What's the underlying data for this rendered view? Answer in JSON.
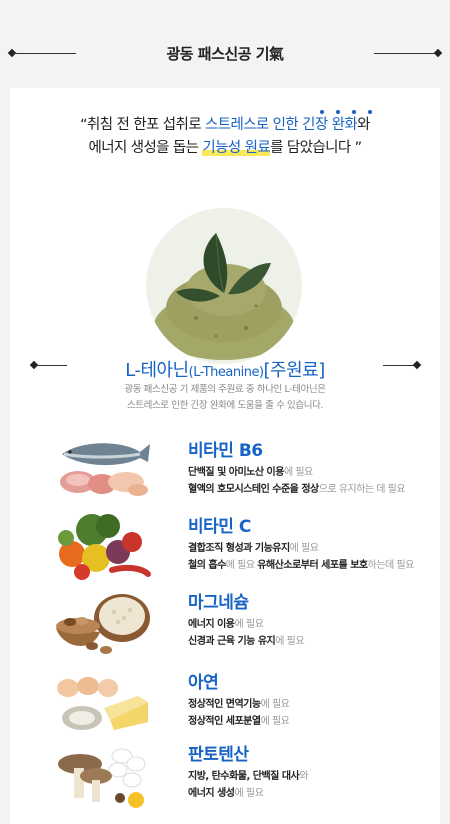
{
  "header": {
    "title": "광동 패스신공 기氣"
  },
  "quote": {
    "line1_pre": "“취침 전 한포 섭취로 ",
    "line1_blue": "스트레스로 인한 긴장 완화",
    "line1_post": "와",
    "line2_pre": "에너지 생성을 돕는 ",
    "line2_hl": "기능성 원료",
    "line2_post": "를 담았습니다 ”"
  },
  "theanine": {
    "title_main": "L-테아닌",
    "title_en": "(L-Theanine)",
    "title_tag": "[주원료]",
    "desc_line1": "광동 패스신공 기 제품의 주원료 중 하나인 L-테아닌은",
    "desc_line2": "스트레스로 인한 긴장 완화에 도움을 줄 수 있습니다."
  },
  "nutrients": [
    {
      "name": "비타민 B6",
      "lines": [
        [
          {
            "t": "단백질 및 아미노산 이용",
            "b": true
          },
          {
            "t": "에 필요",
            "b": false
          }
        ],
        [
          {
            "t": "혈액의 호모시스테인 수준을 정상",
            "b": true
          },
          {
            "t": "으로 유지하는 데 필요",
            "b": false
          }
        ]
      ]
    },
    {
      "name": "비타민 C",
      "lines": [
        [
          {
            "t": "결합조직 형성과 기능유지",
            "b": true
          },
          {
            "t": "에 필요",
            "b": false
          }
        ],
        [
          {
            "t": "철의 흡수",
            "b": true
          },
          {
            "t": "에 필요 ",
            "b": false
          },
          {
            "t": "유해산소로부터 세포를 보호",
            "b": true
          },
          {
            "t": "하는데 필요",
            "b": false
          }
        ]
      ]
    },
    {
      "name": "마그네슘",
      "lines": [
        [
          {
            "t": "에너지 이용",
            "b": true
          },
          {
            "t": "에 필요",
            "b": false
          }
        ],
        [
          {
            "t": "신경과 근육 기능 유지",
            "b": true
          },
          {
            "t": "에 필요",
            "b": false
          }
        ]
      ]
    },
    {
      "name": "아연",
      "lines": [
        [
          {
            "t": "정상적인 면역기능",
            "b": true
          },
          {
            "t": "에 필요",
            "b": false
          }
        ],
        [
          {
            "t": "정상적인 세포분열",
            "b": true
          },
          {
            "t": "에 필요",
            "b": false
          }
        ]
      ]
    },
    {
      "name": "판토텐산",
      "lines": [
        [
          {
            "t": "지방, 탄수화물, 단백질 대사",
            "b": true
          },
          {
            "t": "와",
            "b": false
          }
        ],
        [
          {
            "t": "에너지 생성",
            "b": true
          },
          {
            "t": "에 필요",
            "b": false
          }
        ]
      ]
    }
  ],
  "colors": {
    "accent": "#1763c6",
    "highlight": "#f8e85a"
  }
}
